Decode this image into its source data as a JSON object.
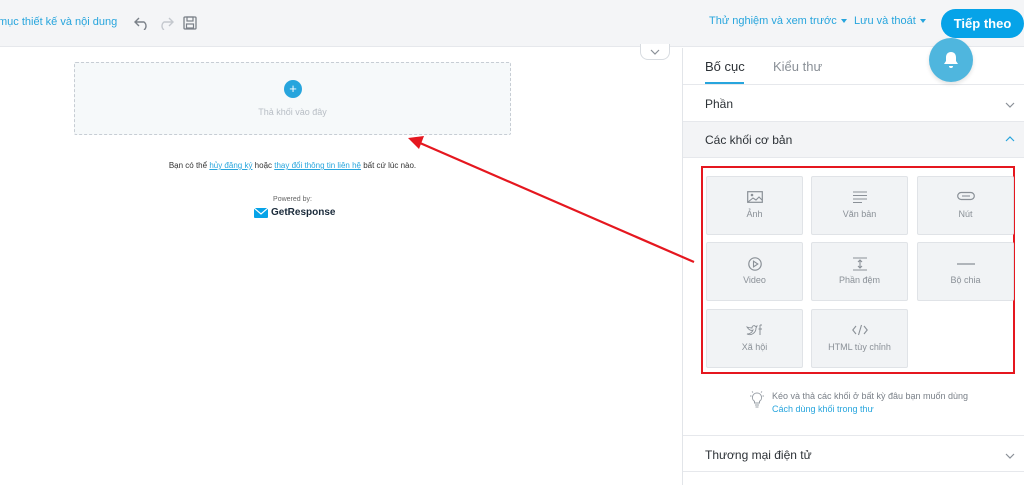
{
  "topbar": {
    "breadcrumb": "mục thiết kế và nội dung",
    "preview_menu": "Thử nghiệm và xem trước",
    "save_menu": "Lưu và thoát",
    "next_button": "Tiếp theo"
  },
  "canvas": {
    "drop_text": "Thả khối vào đây",
    "footer_prefix": "Bạn có thể ",
    "unsubscribe_link": "hủy đăng ký",
    "footer_middle": " hoặc ",
    "change_contact_link": "thay đổi thông tin liên hệ",
    "footer_suffix": " bất cứ lúc nào.",
    "powered_by": "Powered by:",
    "brand": "GetResponse"
  },
  "panel": {
    "tabs": [
      {
        "label": "Bố cục",
        "active": true
      },
      {
        "label": "Kiểu thư",
        "active": false
      }
    ],
    "sections": {
      "phan": "Phần",
      "basic_blocks": "Các khối cơ bản",
      "ecommerce": "Thương mại điện tử"
    },
    "blocks": [
      {
        "label": "Ảnh",
        "icon": "image-icon"
      },
      {
        "label": "Văn bản",
        "icon": "text-icon"
      },
      {
        "label": "Nút",
        "icon": "button-icon"
      },
      {
        "label": "Video",
        "icon": "video-icon"
      },
      {
        "label": "Phần đệm",
        "icon": "spacer-icon"
      },
      {
        "label": "Bộ chia",
        "icon": "divider-icon"
      },
      {
        "label": "Xã hội",
        "icon": "social-icon"
      },
      {
        "label": "HTML tùy chỉnh",
        "icon": "code-icon"
      }
    ],
    "hint_text": "Kéo và thả các khối ở bất kỳ đâu bạn muốn dùng",
    "hint_link": "Cách dùng khối trong thư"
  },
  "colors": {
    "accent": "#27a5dd",
    "button": "#06a3e8",
    "annotation": "#e5171f"
  }
}
